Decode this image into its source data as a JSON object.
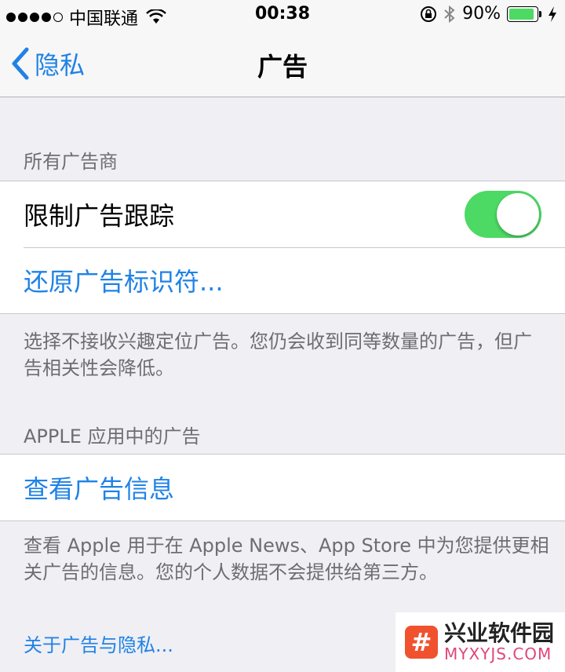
{
  "status_bar": {
    "carrier": "中国联通",
    "time": "00:38",
    "battery_percent": "90%",
    "battery_level": 0.9,
    "icons": [
      "signal-icon",
      "wifi-icon",
      "rotation-lock-icon",
      "bluetooth-icon",
      "battery-icon",
      "charging-icon"
    ]
  },
  "nav": {
    "back_label": "隐私",
    "title": "广告"
  },
  "section_all": {
    "header": "所有广告商",
    "limit_tracking_label": "限制广告跟踪",
    "limit_tracking_on": true,
    "reset_label": "还原广告标识符...",
    "footer": "选择不接收兴趣定位广告。您仍会收到同等数量的广告，但广告相关性会降低。"
  },
  "section_apple": {
    "header": "APPLE 应用中的广告",
    "view_info_label": "查看广告信息",
    "footer": "查看 Apple 用于在 Apple News、App Store 中为您提供更相关广告的信息。您的个人数据不会提供给第三方。"
  },
  "about_link": "关于广告与隐私...",
  "watermark": {
    "logo_glyph": "#",
    "title": "兴业软件园",
    "subtitle": "MYXYJS.COM"
  },
  "colors": {
    "accent": "#1f82e6",
    "toggle_on": "#4cd964",
    "background": "#efeff4"
  }
}
